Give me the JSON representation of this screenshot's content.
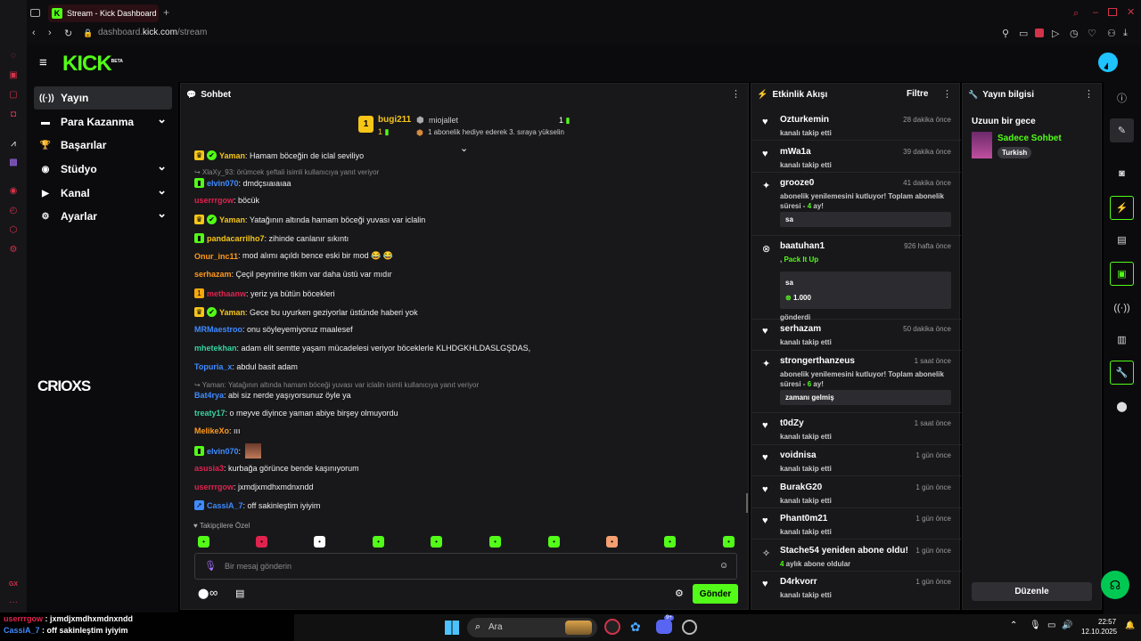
{
  "browser": {
    "tab_title": "Stream - Kick Dashboard",
    "url_host": "dashboard.",
    "url_domain": "kick.com",
    "url_path": "/stream"
  },
  "kick": {
    "logo": "KICK",
    "logo_badge": "BETA"
  },
  "nav": [
    {
      "label": "Yayın",
      "icon": "radio-icon",
      "glyph": "((·))",
      "active": true,
      "chevron": false
    },
    {
      "label": "Para Kazanma",
      "icon": "money-icon",
      "glyph": "▬",
      "chevron": true
    },
    {
      "label": "Başarılar",
      "icon": "trophy-icon",
      "glyph": "🏆",
      "chevron": false
    },
    {
      "label": "Stüdyo",
      "icon": "studio-icon",
      "glyph": "◉",
      "chevron": true
    },
    {
      "label": "Kanal",
      "icon": "channel-icon",
      "glyph": "▶",
      "chevron": true
    },
    {
      "label": "Ayarlar",
      "icon": "gear-icon",
      "glyph": "⚙",
      "chevron": true
    }
  ],
  "side_logo": "CRIOXS",
  "chat": {
    "title": "Sohbet",
    "pinned": {
      "user1": "bugi211",
      "user1_count": "1",
      "user2": "miojallet",
      "user2_count": "1",
      "message": "1 abonelik hediye ederek 3. sıraya yükselin"
    },
    "messages": [
      {
        "type": "msg",
        "user": "Yaman",
        "color": "#f5c518",
        "text": ": Hamam böceğin de iclal seviliyo",
        "badges": [
          "crown",
          "verified"
        ]
      },
      {
        "type": "reply",
        "text": "↪ XlaXy_93: örümcek şeftali isimli kullanıcıya yanıt veriyor"
      },
      {
        "type": "msg",
        "user": "elvin070",
        "color": "#3f8bff",
        "text": ": dmdçsıaıaıaa",
        "badges": [
          "green"
        ]
      },
      {
        "type": "msg",
        "user": "userrrgow",
        "color": "#e0234e",
        "text": ": böcük",
        "badges": []
      },
      {
        "type": "msg",
        "user": "Yaman",
        "color": "#f5c518",
        "text": ": Yatağının altında hamam böceği yuvası var iclalin",
        "badges": [
          "crown",
          "verified"
        ]
      },
      {
        "type": "msg",
        "user": "pandacarrilho7",
        "color": "#f5c518",
        "text": ": zihinde canlanır sıkıntı",
        "badges": [
          "green"
        ]
      },
      {
        "type": "msg",
        "user": "Onur_inc11",
        "color": "#ff9a1a",
        "text": ": mod alımı açıldı bence eski bir mod 😂 😂",
        "badges": []
      },
      {
        "type": "msg",
        "user": "serhazam",
        "color": "#ff9a1a",
        "text": ": Çeçil peynirine tikim var daha üstü var mıdır",
        "badges": []
      },
      {
        "type": "msg",
        "user": "methaanw",
        "color": "#e0234e",
        "text": ": yeriz ya bütün böcekleri",
        "badges": [
          "coin"
        ]
      },
      {
        "type": "msg",
        "user": "Yaman",
        "color": "#f5c518",
        "text": ": Gece bu uyurken geziyorlar üstünde haberi yok",
        "badges": [
          "crown",
          "verified"
        ]
      },
      {
        "type": "msg",
        "user": "MRMaestroo",
        "color": "#3f8bff",
        "text": ": onu söyleyemiyoruz maalesef",
        "badges": []
      },
      {
        "type": "msg",
        "user": "mhetekhan",
        "color": "#38d39f",
        "text": ": adam elit semtte yaşam mücadelesi veriyor böceklerle KLHDGKHLDASLGŞDAS,",
        "badges": []
      },
      {
        "type": "msg",
        "user": "Topuria_x",
        "color": "#3f8bff",
        "text": ": abdul basit adam",
        "badges": []
      },
      {
        "type": "reply",
        "text": "↪ Yaman: Yatağının altında hamam böceği yuvası var iclalin isimli kullanıcıya yanıt veriyor"
      },
      {
        "type": "msg",
        "user": "Bat4rya",
        "color": "#3f8bff",
        "text": ": abi siz nerde yaşıyorsunuz öyle ya",
        "badges": []
      },
      {
        "type": "msg",
        "user": "treaty17",
        "color": "#38d39f",
        "text": ": o meyve diyince yaman abiye birşey olmuyordu",
        "badges": []
      },
      {
        "type": "msg",
        "user": "MelikeXo",
        "color": "#ff9a1a",
        "text": ": ııı",
        "badges": []
      },
      {
        "type": "msg",
        "user": "elvin070",
        "color": "#3f8bff",
        "text": ": ",
        "badges": [
          "green"
        ],
        "emoteimg": true
      },
      {
        "type": "msg",
        "user": "asusia3",
        "color": "#e0234e",
        "text": ": kurbağa görünce bende kaşınıyorum",
        "badges": []
      },
      {
        "type": "msg",
        "user": "userrrgow",
        "color": "#e0234e",
        "text": ": jxmdjxmdhxmdnxndd",
        "badges": []
      },
      {
        "type": "msg",
        "user": "CassiA_7",
        "color": "#3f8bff",
        "text": ": off sakinleştim iyiyim",
        "badges": [
          "blue"
        ]
      }
    ],
    "followers_only": "Takipçilere Özel",
    "input_placeholder": "Bir mesaj gönderin",
    "send_label": "Gönder",
    "infinity": "∞"
  },
  "activity": {
    "title": "Etkinlik Akışı",
    "filter_label": "Filtre",
    "items": [
      {
        "name": "Ozturkemin",
        "time": "28 dakika önce",
        "sub": "kanalı takip etti",
        "icon": "heart"
      },
      {
        "name": "mWa1a",
        "time": "39 dakika önce",
        "sub": "kanalı takip etti",
        "icon": "heart"
      },
      {
        "name": "grooze0",
        "time": "41 dakika önce",
        "sub": "abonelik yenilemesini kutluyor! Toplam abonelik süresi - ",
        "sub_hl": "4",
        "sub_end": " ay!",
        "box": "sa",
        "icon": "sub"
      },
      {
        "name": "baatuhan1",
        "time": "926 hafta önce",
        "sub_pre": ", ",
        "sub_green": "Pack It Up",
        "box": "sa",
        "kicks": "1.000",
        "after": "gönderdi",
        "icon": "kick"
      },
      {
        "name": "serhazam",
        "time": "50 dakika önce",
        "sub": "kanalı takip etti",
        "icon": "heart"
      },
      {
        "name": "strongerthanzeus",
        "time": "1 saat önce",
        "sub": "abonelik yenilemesini kutluyor! Toplam abonelik süresi - ",
        "sub_hl": "6",
        "sub_end": " ay!",
        "box": "zamanı gelmiş",
        "icon": "sub"
      },
      {
        "name": "t0dZy",
        "time": "1 saat önce",
        "sub": "kanalı takip etti",
        "icon": "heart"
      },
      {
        "name": "voidnisa",
        "time": "1 gün önce",
        "sub": "kanalı takip etti",
        "icon": "heart"
      },
      {
        "name": "BurakG20",
        "time": "1 gün önce",
        "sub": "kanalı takip etti",
        "icon": "heart"
      },
      {
        "name": "Phant0m21",
        "time": "1 gün önce",
        "sub": "kanalı takip etti",
        "icon": "heart"
      },
      {
        "name": "Stache54 yeniden abone oldu!",
        "time": "1 gün önce",
        "sub_hl": "4",
        "sub": " aylık abone oldular",
        "icon": "spark"
      },
      {
        "name": "D4rkvorr",
        "time": "1 gün önce",
        "sub": "kanalı takip etti",
        "icon": "heart"
      }
    ]
  },
  "stream_info": {
    "title": "Yayın bilgisi",
    "stream_title": "Uzuun bir gece",
    "category": "Sadece Sohbet",
    "tag": "Turkish",
    "edit_label": "Düzenle"
  },
  "overlay": [
    {
      "user": "userrrgow",
      "text": " : jxmdjxmdhxmdnxndd",
      "color": "#e0234e"
    },
    {
      "user": "CassiA_7",
      "text": " : off sakinleştim iyiyim",
      "color": "#3f8bff"
    }
  ],
  "taskbar": {
    "search_placeholder": "Ara",
    "time": "22:57",
    "date": "12.10.2025",
    "discord_badge": "9+"
  },
  "colors": {
    "accent": "#53fc18",
    "opera_red": "#d2334a"
  }
}
